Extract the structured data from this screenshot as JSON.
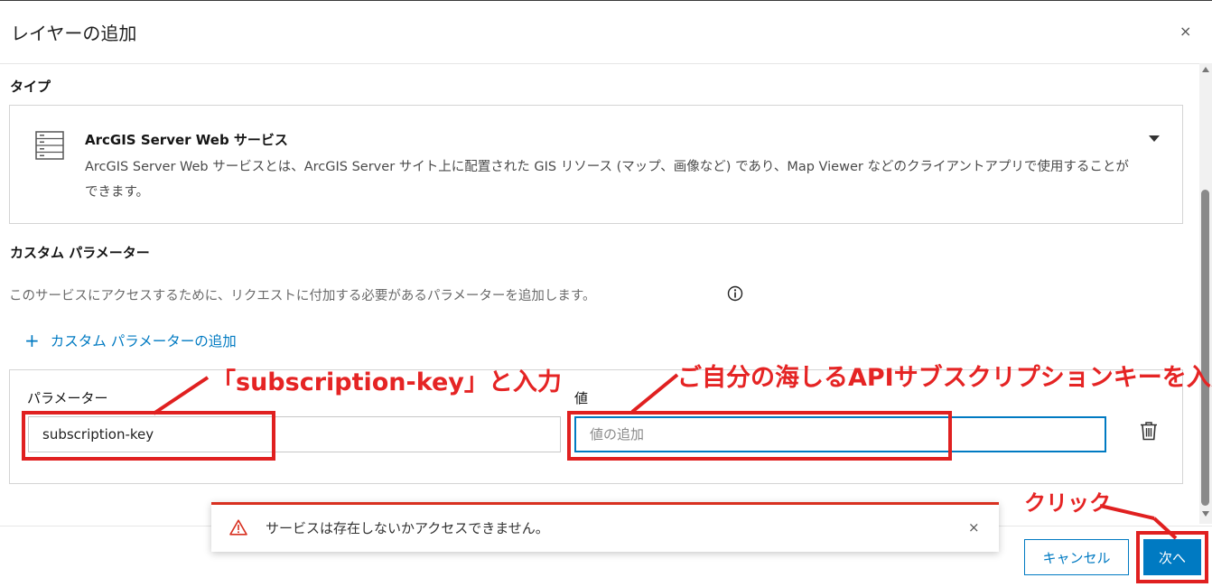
{
  "dialog": {
    "title": "レイヤーの追加",
    "close_glyph": "×"
  },
  "type_section": {
    "label": "タイプ",
    "selected_title": "ArcGIS Server Web サービス",
    "selected_desc": "ArcGIS Server Web サービスとは、ArcGIS Server サイト上に配置された GIS リソース (マップ、画像など) であり、Map Viewer などのクライアントアプリで使用することができます。"
  },
  "custom_params": {
    "label": "カスタム パラメーター",
    "helper": "このサービスにアクセスするために、リクエストに付加する必要があるパラメーターを追加します。",
    "add_link_plus": "+",
    "add_link": "カスタム パラメーターの追加",
    "param_label": "パラメーター",
    "param_value": "subscription-key",
    "value_label": "値",
    "value_placeholder": "値の追加"
  },
  "toast": {
    "message": "サービスは存在しないかアクセスできません。",
    "close_glyph": "×"
  },
  "footer": {
    "cancel_label": "キャンセル",
    "next_label": "次へ"
  },
  "annotations": {
    "param_note": "「subscription-key」と入力",
    "value_note": "ご自分の海しるAPIサブスクリプションキーを入力",
    "click_note": "クリック"
  },
  "colors": {
    "accent": "#007ac2",
    "danger": "#d83020",
    "annotation": "#e52424"
  }
}
